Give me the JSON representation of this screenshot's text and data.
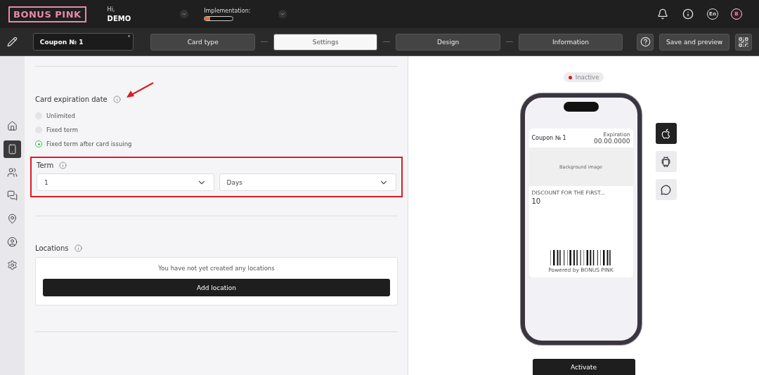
{
  "header": {
    "logo": "BONUS PINK",
    "greeting": "Hi,",
    "user": "DEMO",
    "implementation": {
      "label": "Implementation:",
      "level": 0.2
    },
    "language": "En",
    "avatar": "B"
  },
  "toolbar": {
    "card_name": "Coupon № 1",
    "required_mark": "*",
    "steps": [
      {
        "label": "Card type",
        "selected": false
      },
      {
        "label": "Settings",
        "selected": true
      },
      {
        "label": "Design",
        "selected": false
      },
      {
        "label": "Information",
        "selected": false
      }
    ],
    "save_button": "Save and preview"
  },
  "sidebar": {
    "items": [
      {
        "kind": "home",
        "selected": false
      },
      {
        "kind": "card",
        "selected": true
      },
      {
        "kind": "clients",
        "selected": false
      },
      {
        "kind": "chat",
        "selected": false
      },
      {
        "kind": "location",
        "selected": false
      },
      {
        "kind": "user",
        "selected": false
      },
      {
        "kind": "settings",
        "selected": false
      }
    ]
  },
  "expiration": {
    "title": "Card expiration date",
    "options": [
      {
        "label": "Unlimited",
        "selected": false
      },
      {
        "label": "Fixed term",
        "selected": false
      },
      {
        "label": "Fixed term after card issuing",
        "selected": true
      }
    ]
  },
  "term": {
    "title": "Term",
    "amount": "1",
    "unit": "Days"
  },
  "locations": {
    "title": "Locations",
    "empty_text": "You have not yet created any locations",
    "add_button": "Add location"
  },
  "preview": {
    "status": "Inactive",
    "card_name": "Coupon № 1",
    "expiration_label": "Expiration",
    "expiration_value": "00.00.0000",
    "image_label": "Background image",
    "field_label": "DISCOUNT FOR THE FIRST...",
    "field_value": "10",
    "powered_by": "Powered by BONUS PINK",
    "platforms": [
      {
        "kind": "apple",
        "selected": true
      },
      {
        "kind": "android",
        "selected": false
      },
      {
        "kind": "chat",
        "selected": false
      }
    ],
    "activate_button": "Activate"
  }
}
